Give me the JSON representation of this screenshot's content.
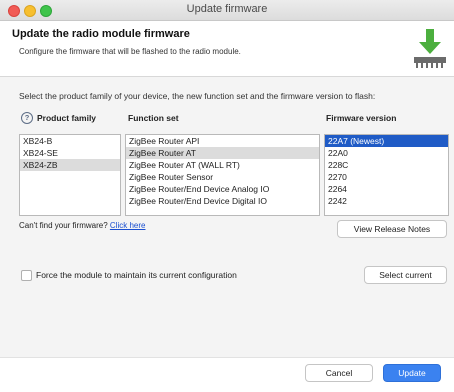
{
  "window": {
    "title": "Update firmware"
  },
  "header": {
    "title": "Update the radio module firmware",
    "description": "Configure the firmware that will be flashed to the radio module.",
    "icon": "download-firmware-icon"
  },
  "instruction": "Select the product family of your device, the new function set and the firmware version to flash:",
  "columns": {
    "product_family": "Product family",
    "function_set": "Function set",
    "firmware_version": "Firmware version"
  },
  "product_families": [
    "XB24-B",
    "XB24-SE",
    "XB24-ZB"
  ],
  "selected_product_family": "XB24-ZB",
  "function_sets": [
    "ZigBee Router API",
    "ZigBee Router AT",
    "ZigBee Router AT (WALL RT)",
    "ZigBee Router Sensor",
    "ZigBee Router/End Device Analog IO",
    "ZigBee Router/End Device Digital IO"
  ],
  "selected_function_set": "ZigBee Router AT",
  "firmware_versions": [
    "22A7 (Newest)",
    "22A0",
    "228C",
    "2270",
    "2264",
    "2242"
  ],
  "selected_firmware_version": "22A7 (Newest)",
  "cant_find": {
    "text": "Can't find your firmware?",
    "link": "Click here"
  },
  "buttons": {
    "view_release_notes": "View Release Notes",
    "select_current": "Select current",
    "cancel": "Cancel",
    "update": "Update"
  },
  "force_config": {
    "label": "Force the module to maintain its current configuration",
    "checked": false
  },
  "colors": {
    "accent": "#3b82f0",
    "selection_blue": "#1f5bc6",
    "link": "#1a4fd0"
  }
}
